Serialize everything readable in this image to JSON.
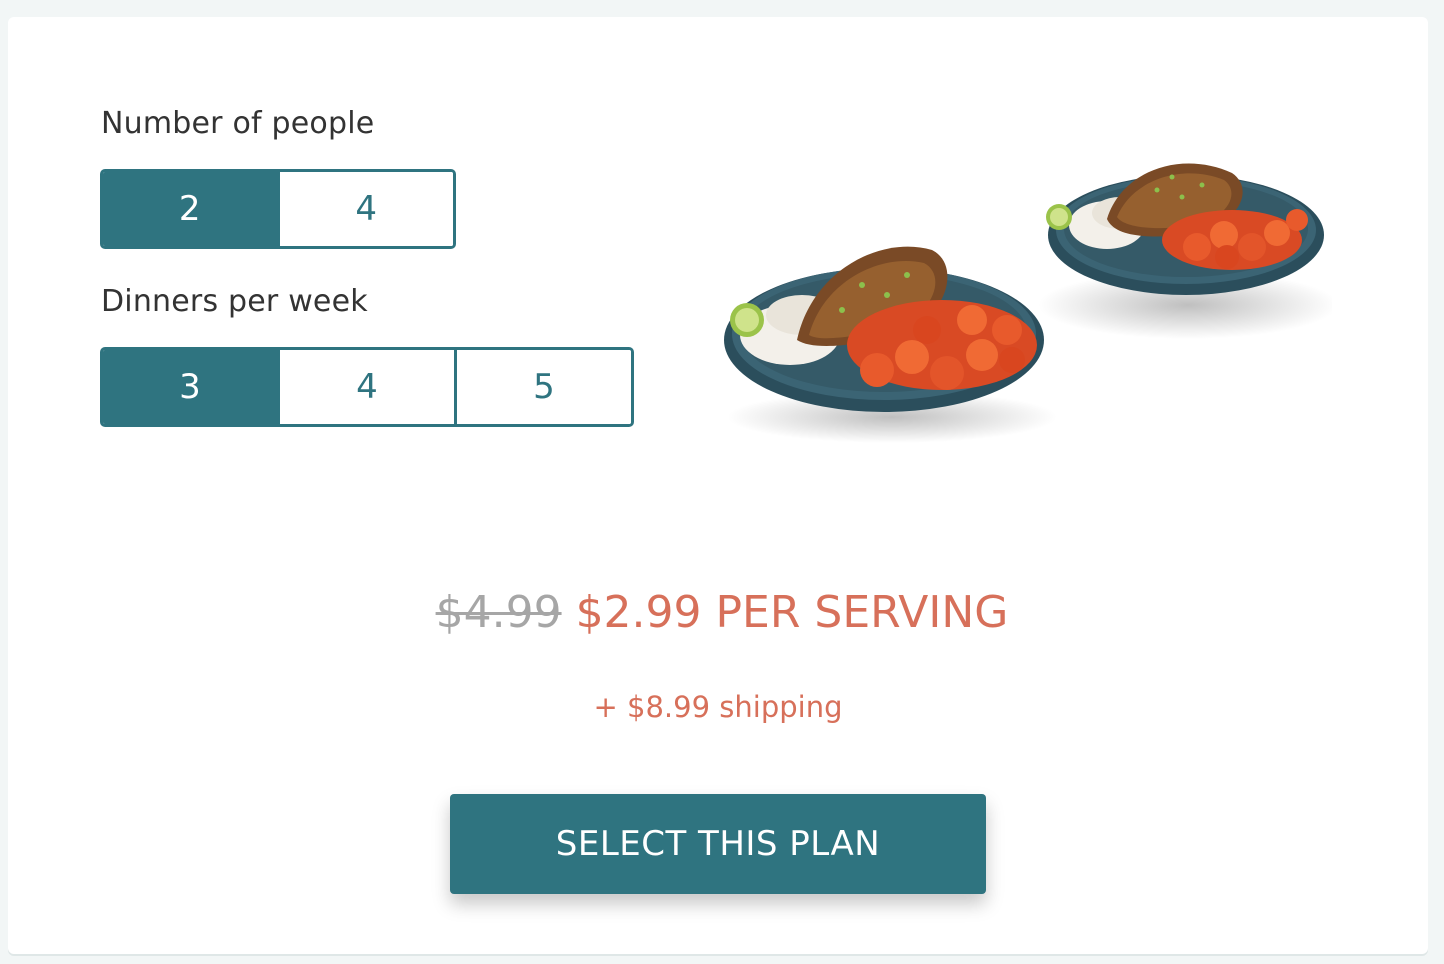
{
  "people": {
    "label": "Number of people",
    "options": [
      "2",
      "4"
    ],
    "selected": "2"
  },
  "dinners": {
    "label": "Dinners per week",
    "options": [
      "3",
      "4",
      "5"
    ],
    "selected": "3"
  },
  "pricing": {
    "old_price": "$4.99",
    "new_price": "$2.99 PER SERVING",
    "shipping": "+ $8.99 shipping"
  },
  "cta": {
    "label": "SELECT THIS PLAN"
  },
  "image": {
    "icon": "meal-plates-image"
  },
  "colors": {
    "primary": "#2f7480",
    "accent": "#d7705a",
    "strike": "#a6a6a6",
    "text": "#333333",
    "background": "#f2f6f6"
  }
}
